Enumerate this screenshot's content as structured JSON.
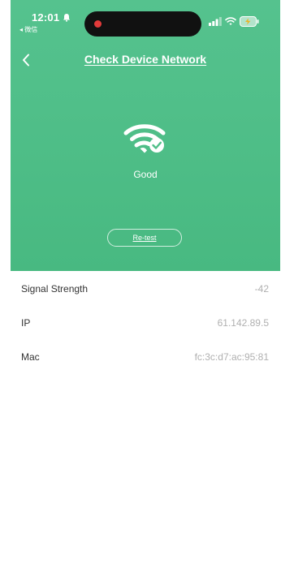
{
  "status_bar": {
    "time": "12:01",
    "back_app": "◂ 微信"
  },
  "header": {
    "title": "Check Device Network"
  },
  "network": {
    "status": "Good",
    "retest_label": "Re-test"
  },
  "info": [
    {
      "label": "Signal Strength",
      "value": "-42"
    },
    {
      "label": "IP",
      "value": "61.142.89.5"
    },
    {
      "label": "Mac",
      "value": "fc:3c:d7:ac:95:81"
    }
  ],
  "colors": {
    "accent": "#50bf89"
  },
  "icons": {
    "back": "chevron-left-icon",
    "network": "wifi-check-icon"
  }
}
